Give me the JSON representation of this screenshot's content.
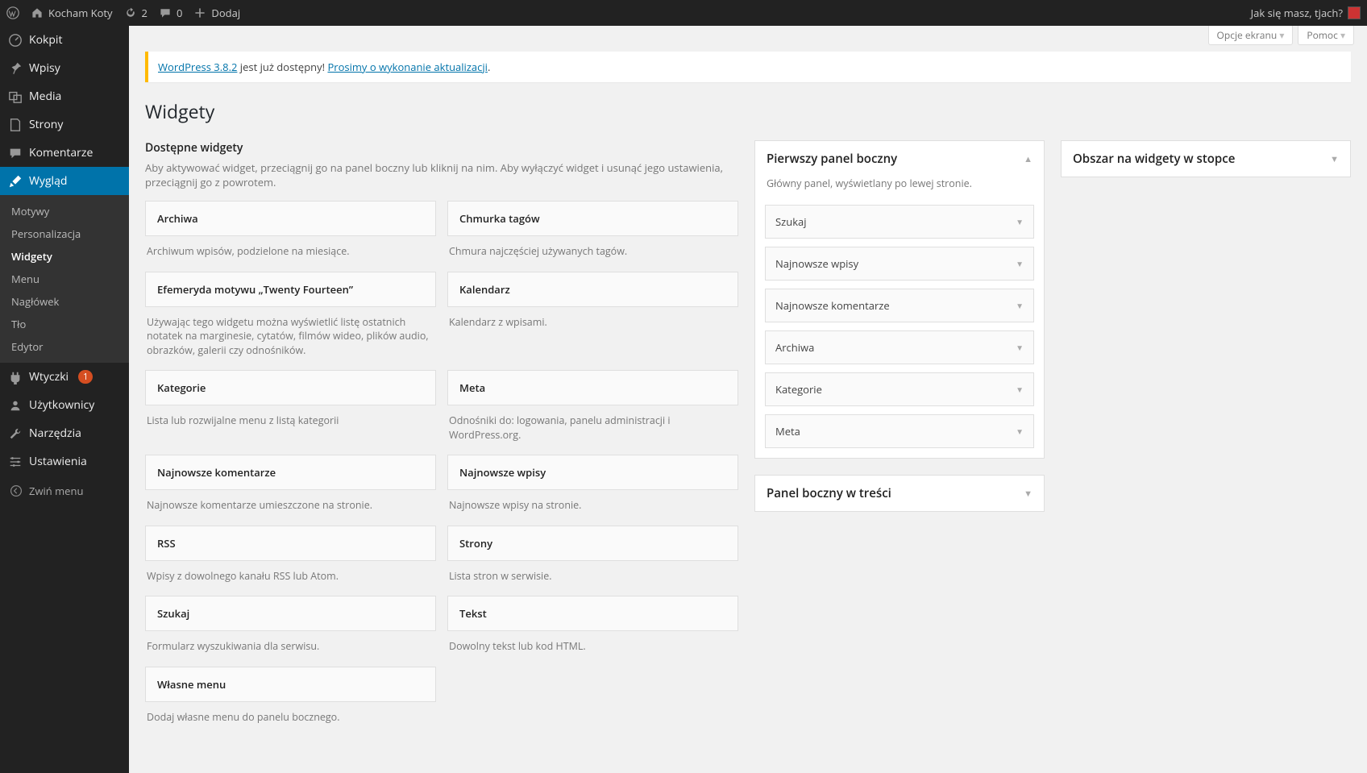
{
  "adminbar": {
    "site_name": "Kocham Koty",
    "updates": "2",
    "comments": "0",
    "add_new": "Dodaj",
    "greeting": "Jak się masz, tjach?"
  },
  "sidebar": {
    "dashboard": "Kokpit",
    "posts": "Wpisy",
    "media": "Media",
    "pages": "Strony",
    "comments": "Komentarze",
    "appearance": "Wygląd",
    "appearance_sub": {
      "themes": "Motywy",
      "customize": "Personalizacja",
      "widgets": "Widgety",
      "menus": "Menu",
      "header": "Nagłówek",
      "background": "Tło",
      "editor": "Edytor"
    },
    "plugins": "Wtyczki",
    "plugins_badge": "1",
    "users": "Użytkownicy",
    "tools": "Narzędzia",
    "settings": "Ustawienia",
    "collapse": "Zwiń menu"
  },
  "screen": {
    "options": "Opcje ekranu",
    "help": "Pomoc"
  },
  "notice": {
    "link1": "WordPress 3.8.2",
    "text": " jest już dostępny! ",
    "link2": "Prosimy o wykonanie aktualizacji",
    "dot": "."
  },
  "page_title": "Widgety",
  "available": {
    "heading": "Dostępne widgety",
    "description": "Aby aktywować widget, przeciągnij go na panel boczny lub kliknij na nim. Aby wyłączyć widget i usunąć jego ustawienia, przeciągnij go z powrotem.",
    "widgets": [
      {
        "title": "Archiwa",
        "desc": "Archiwum wpisów, podzielone na miesiące."
      },
      {
        "title": "Chmurka tagów",
        "desc": "Chmura najczęściej używanych tagów."
      },
      {
        "title": "Efemeryda motywu „Twenty Fourteen”",
        "desc": "Używając tego widgetu można wyświetlić listę ostatnich notatek na marginesie, cytatów, filmów wideo, plików audio, obrazków, galerii czy odnośników."
      },
      {
        "title": "Kalendarz",
        "desc": "Kalendarz z wpisami."
      },
      {
        "title": "Kategorie",
        "desc": "Lista lub rozwijalne menu z listą kategorii"
      },
      {
        "title": "Meta",
        "desc": "Odnośniki do: logowania, panelu administracji i WordPress.org."
      },
      {
        "title": "Najnowsze komentarze",
        "desc": "Najnowsze komentarze umieszczone na stronie."
      },
      {
        "title": "Najnowsze wpisy",
        "desc": "Najnowsze wpisy na stronie."
      },
      {
        "title": "RSS",
        "desc": "Wpisy z dowolnego kanału RSS lub Atom."
      },
      {
        "title": "Strony",
        "desc": "Lista stron w serwisie."
      },
      {
        "title": "Szukaj",
        "desc": "Formularz wyszukiwania dla serwisu."
      },
      {
        "title": "Tekst",
        "desc": "Dowolny tekst lub kod HTML."
      },
      {
        "title": "Własne menu",
        "desc": "Dodaj własne menu do panelu bocznego."
      }
    ]
  },
  "sidebars": {
    "primary": {
      "title": "Pierwszy panel boczny",
      "desc": "Główny panel, wyświetlany po lewej stronie.",
      "widgets": [
        "Szukaj",
        "Najnowsze wpisy",
        "Najnowsze komentarze",
        "Archiwa",
        "Kategorie",
        "Meta"
      ]
    },
    "content": {
      "title": "Panel boczny w treści"
    },
    "footer": {
      "title": "Obszar na widgety w stopce"
    }
  }
}
